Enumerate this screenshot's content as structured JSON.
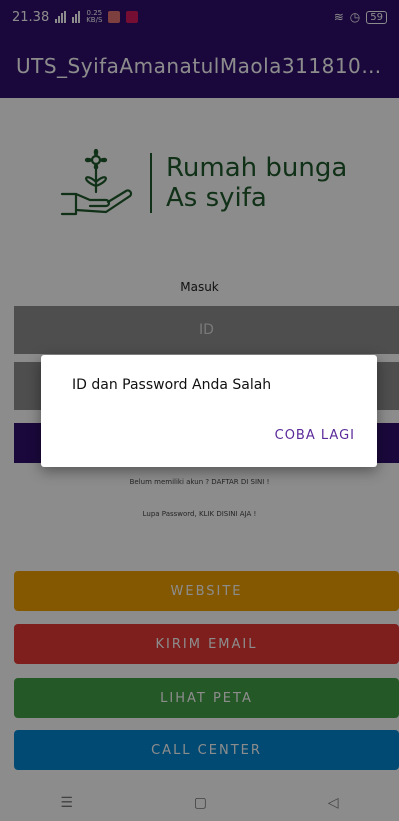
{
  "status_bar": {
    "time": "21.38",
    "network_speed_value": "0.25",
    "network_speed_unit": "KB/S",
    "battery": "59",
    "icons": [
      "signal-icon",
      "wifi-icon",
      "notification-icon",
      "vibrate-icon",
      "alarm-icon",
      "battery-icon"
    ]
  },
  "app_bar": {
    "title": "UTS_SyifaAmanatulMaola3118103..."
  },
  "logo": {
    "line1": "Rumah bunga",
    "line2": "As syifa",
    "color": "#1e5a2b"
  },
  "login": {
    "heading": "Masuk",
    "id_placeholder": "ID",
    "password_placeholder": "",
    "register_text": "Belum memiliki akun ? DAFTAR DI SINI !",
    "forgot_text": "Lupa Password, KLIK DISINI AJA !"
  },
  "buttons": {
    "website": "WEBSITE",
    "email": "KIRIM EMAIL",
    "map": "LIHAT PETA",
    "call": "CALL CENTER"
  },
  "colors": {
    "primary": "#30106e",
    "website": "#f0a000",
    "email": "#e53935",
    "map": "#43a047",
    "call": "#0288d1"
  },
  "nav_bar": {
    "icons": [
      "menu-icon",
      "home-icon",
      "back-icon"
    ]
  },
  "dialog": {
    "message": "ID dan Password Anda Salah",
    "button": "COBA LAGI"
  }
}
